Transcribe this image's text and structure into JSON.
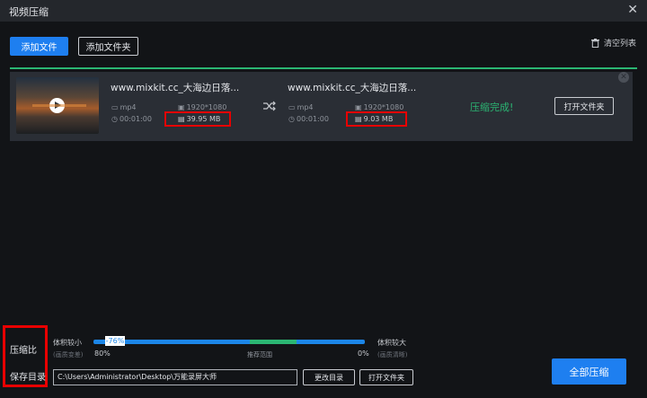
{
  "window": {
    "title": "视频压缩"
  },
  "toolbar": {
    "add_file": "添加文件",
    "add_folder": "添加文件夹",
    "clear_list": "清空列表"
  },
  "item": {
    "source": {
      "name": "www.mixkit.cc_大海边日落...",
      "format": "mp4",
      "resolution": "1920*1080",
      "duration": "00:01:00",
      "size": "39.95 MB"
    },
    "output": {
      "name": "www.mixkit.cc_大海边日落...",
      "format": "mp4",
      "resolution": "1920*1080",
      "duration": "00:01:00",
      "size": "9.03 MB"
    },
    "status": "压缩完成!",
    "open_folder": "打开文件夹"
  },
  "bottom": {
    "ratio_label": "压缩比",
    "save_dir_label": "保存目录",
    "small_label": "体积较小",
    "small_sub": "(画质变差)",
    "large_label": "体积较大",
    "large_sub": "(画质清晰)",
    "min_value": "80%",
    "max_value": "0%",
    "recommended": "推荐范围",
    "handle_value": "-76%",
    "path": "C:\\Users\\Administrator\\Desktop\\万能录屏大师",
    "change_dir": "更改目录",
    "open_folder": "打开文件夹",
    "compress_all": "全部压缩"
  },
  "colors": {
    "accent": "#1e7ff0",
    "success": "#2bb673",
    "highlight": "#e80000",
    "background": "#121417"
  }
}
